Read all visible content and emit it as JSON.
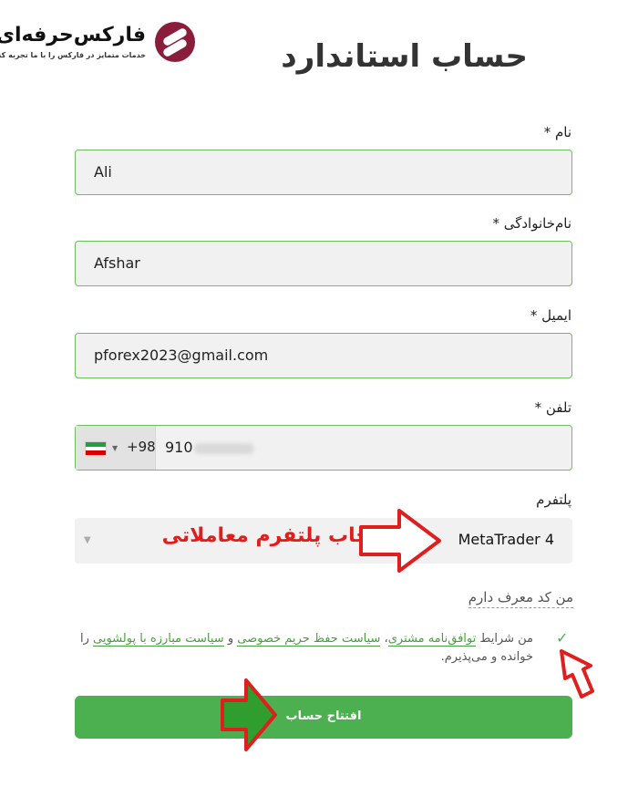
{
  "brand": {
    "name": "فارکس‌حرفه‌ای",
    "tagline": "خدمات متمایز در فارکس را با ما تجربه کنید"
  },
  "page": {
    "title": "حساب استاندارد"
  },
  "form": {
    "first_name": {
      "label": "نام *",
      "value": "Ali"
    },
    "last_name": {
      "label": "نام‌خانوادگی *",
      "value": "Afshar"
    },
    "email": {
      "label": "ایمیل *",
      "value": "pforex2023@gmail.com"
    },
    "phone": {
      "label": "تلفن *",
      "country_code": "+98",
      "value_visible": "910",
      "country_flag": "iran-flag-icon"
    },
    "platform": {
      "label": "پلتفرم",
      "selected": "MetaTrader 4"
    },
    "referral_link": "من کد معرف دارم",
    "terms": {
      "prefix": "من شرایط ",
      "link_agreement": "توافق‌نامه مشتری",
      "sep1": "، ",
      "link_privacy": "سیاست حفظ حریم خصوصی",
      "sep2": " و ",
      "link_aml": "سیاست مبارزه با پولشویی",
      "suffix": " را خوانده و می‌پذیرم."
    },
    "submit_label": "افتتاح حساب"
  },
  "annotations": {
    "platform_note": "انتخاب پلتفرم معاملاتی",
    "arrow_color": "#e01e1e",
    "arrow_fill_green": "#2f9e2f"
  },
  "colors": {
    "accent": "#4caf50",
    "field_border": "#6bbf5c",
    "link": "#4a9d3f",
    "brand": "#8a1c3c"
  }
}
